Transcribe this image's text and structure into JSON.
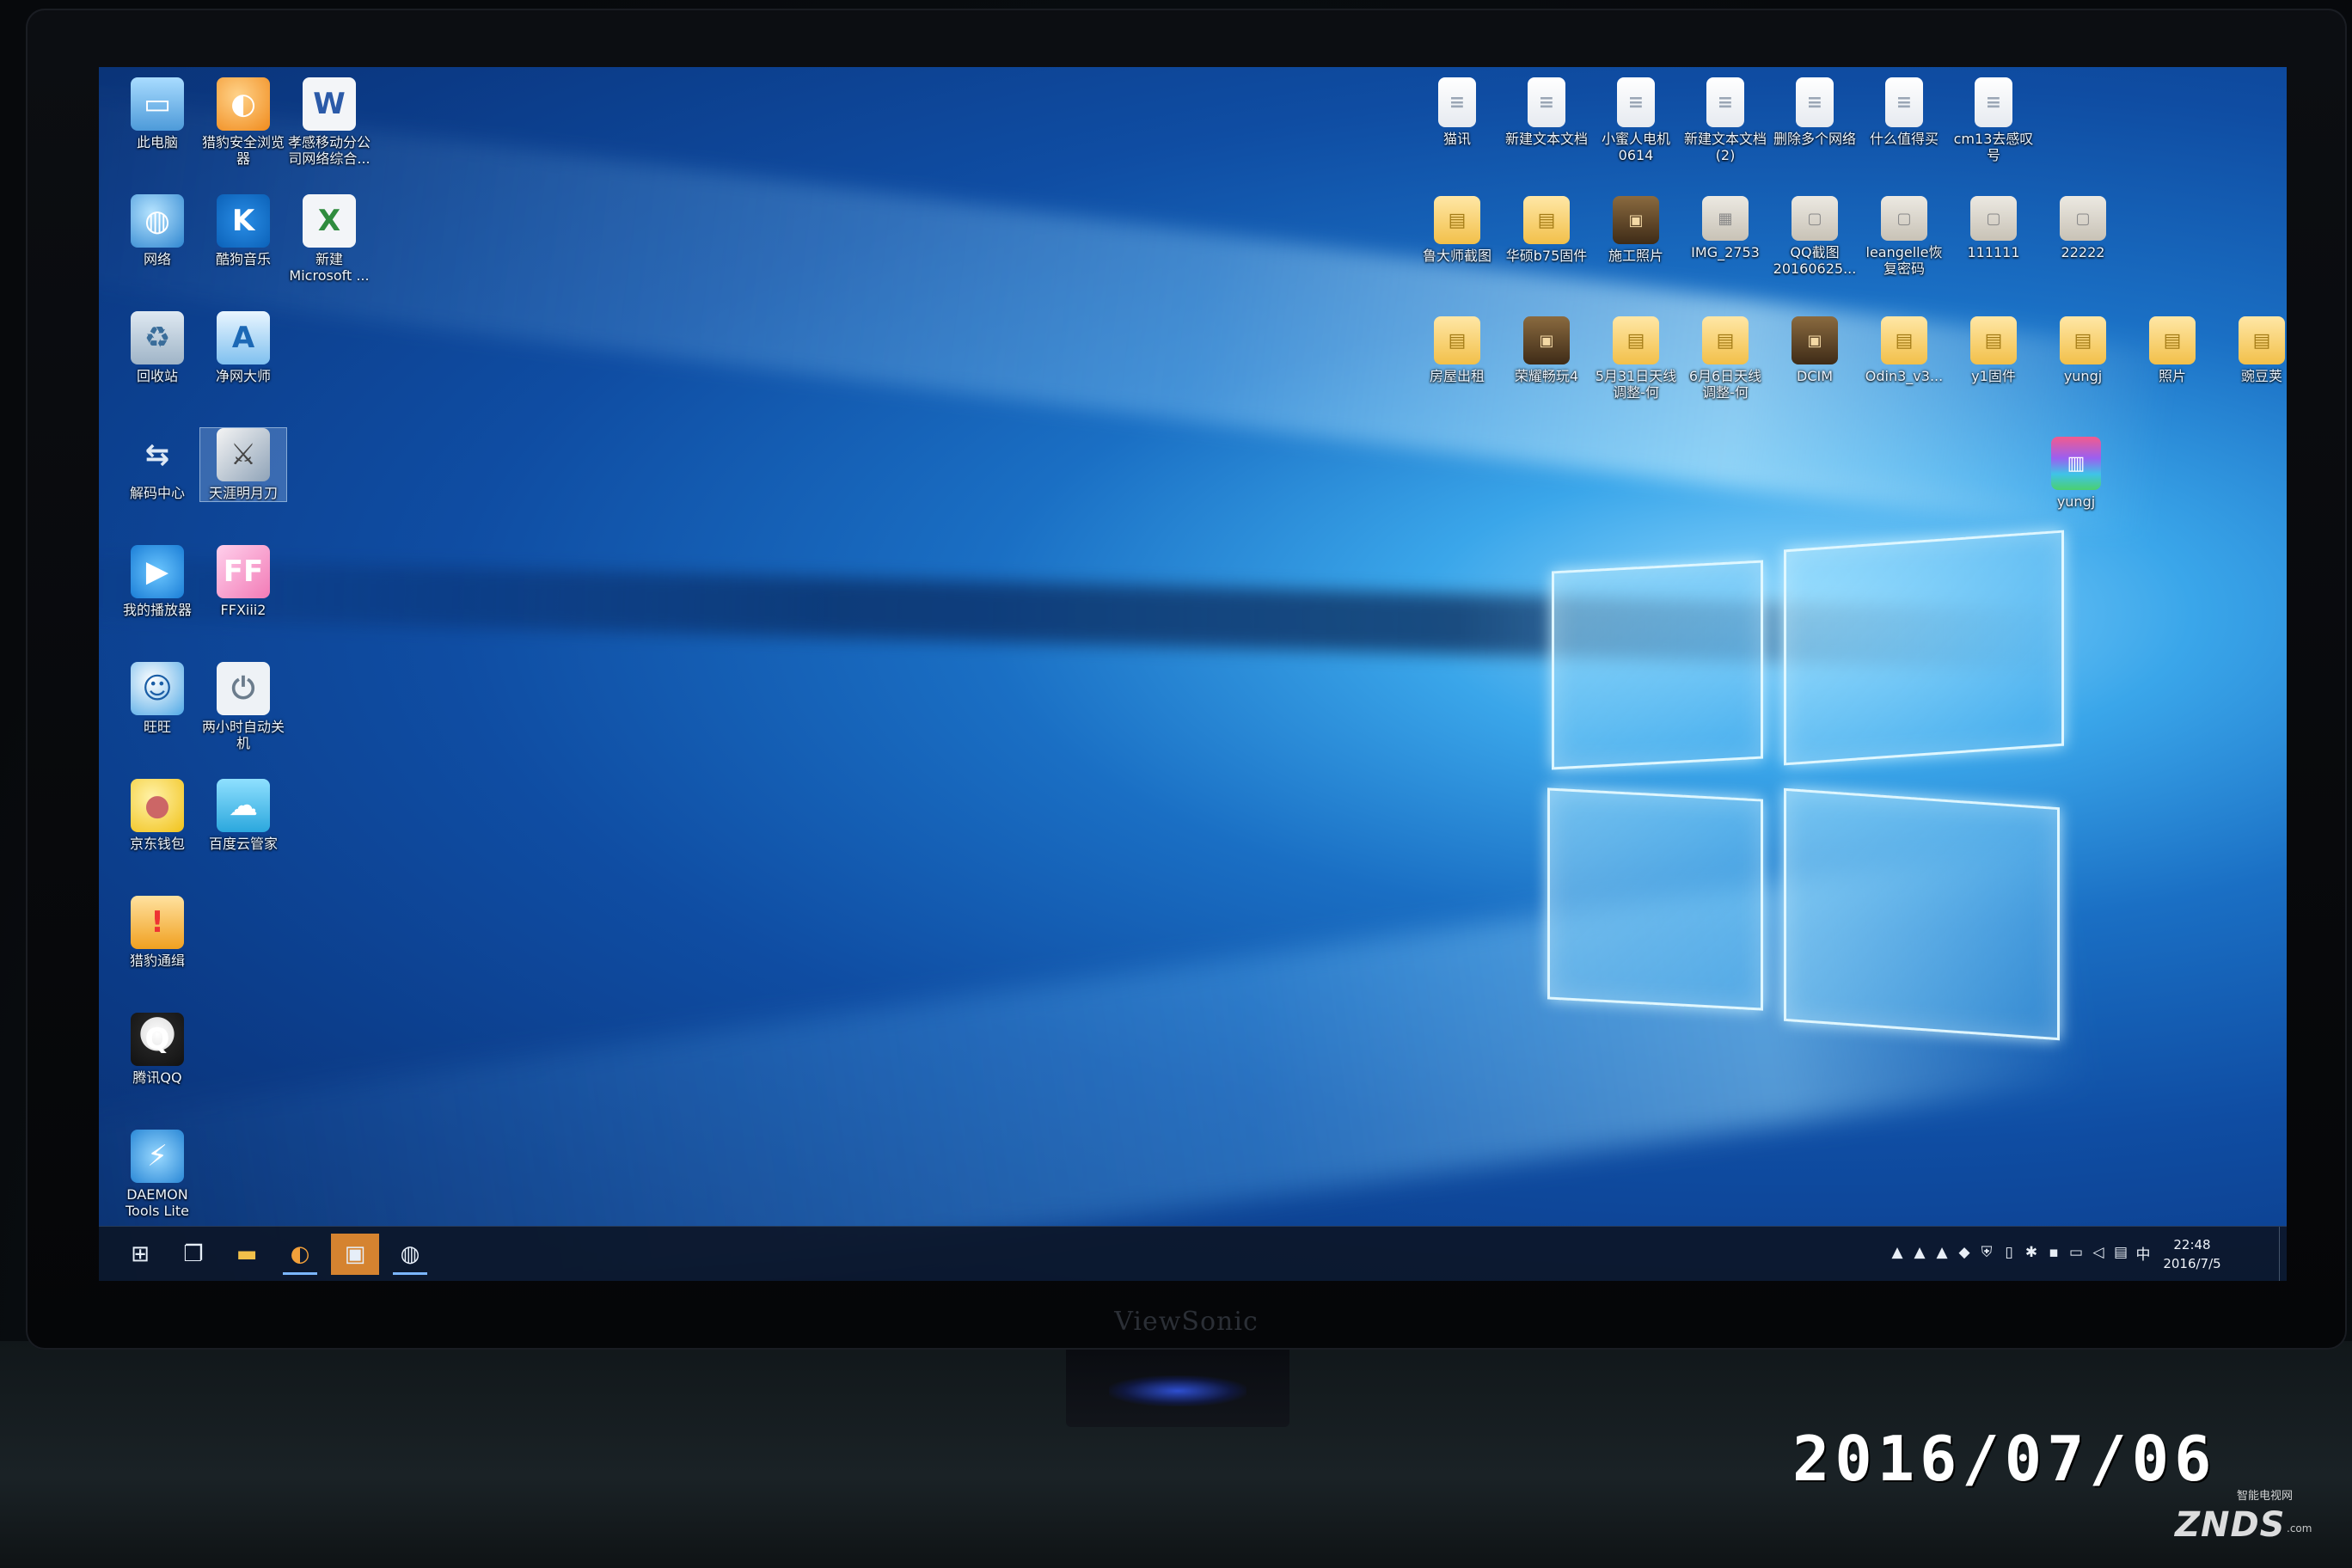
{
  "desktop": {
    "left_icons": [
      {
        "name": "this-pc",
        "label": "此电脑",
        "glyph": "▭",
        "style": "g-pc"
      },
      {
        "name": "liebao-browser",
        "label": "猎豹安全浏览器",
        "glyph": "◐",
        "style": "g-orange"
      },
      {
        "name": "word-doc-mobile",
        "label": "孝感移动分公司网络综合...",
        "glyph": "W",
        "style": "g-doc"
      },
      {
        "name": "network",
        "label": "网络",
        "glyph": "◍",
        "style": "g-net"
      },
      {
        "name": "kugou-music",
        "label": "酷狗音乐",
        "glyph": "K",
        "style": "g-kugou"
      },
      {
        "name": "new-excel",
        "label": "新建 Microsoft ...",
        "glyph": "X",
        "style": "g-xls"
      },
      {
        "name": "recycle-bin",
        "label": "回收站",
        "glyph": "♻",
        "style": "g-bin"
      },
      {
        "name": "jingwang-master",
        "label": "净网大师",
        "glyph": "A",
        "style": "g-clean"
      },
      {
        "name": "decode-center",
        "label": "解码中心",
        "glyph": "⇆",
        "style": "g-decode"
      },
      {
        "name": "tianya-mingyue-dao",
        "label": "天涯明月刀",
        "glyph": "⚔",
        "style": "g-sword",
        "selected": true
      },
      {
        "name": "my-player",
        "label": "我的播放器",
        "glyph": "▶",
        "style": "g-play"
      },
      {
        "name": "ffxiii2",
        "label": "FFXiii2",
        "glyph": "FF",
        "style": "g-fx"
      },
      {
        "name": "wangwang",
        "label": "旺旺",
        "glyph": "☺",
        "style": "g-wang"
      },
      {
        "name": "auto-shutdown",
        "label": "两小时自动关机",
        "glyph": "⏻",
        "style": "g-timer"
      },
      {
        "name": "jd-wallet",
        "label": "京东钱包",
        "glyph": "●",
        "style": "g-jd"
      },
      {
        "name": "baidu-cloud",
        "label": "百度云管家",
        "glyph": "☁",
        "style": "g-cloud"
      },
      {
        "name": "liebao-tongji",
        "label": "猎豹通缉",
        "glyph": "!",
        "style": "g-bz"
      },
      {
        "name": "tencent-qq",
        "label": "腾讯QQ",
        "glyph": "Q",
        "style": "g-qq"
      },
      {
        "name": "daemon-tools",
        "label": "DAEMON Tools Lite",
        "glyph": "⚡",
        "style": "g-daemon"
      }
    ],
    "right_icons_row1": [
      {
        "name": "shortcut-1",
        "label": "猫讯",
        "glyph": "≡",
        "style": "g-file"
      },
      {
        "name": "new-text-1",
        "label": "新建文本文档",
        "glyph": "≡",
        "style": "g-file"
      },
      {
        "name": "xiaomi-laptop",
        "label": "小蜜人电机0614",
        "glyph": "≡",
        "style": "g-file"
      },
      {
        "name": "new-text-2",
        "label": "新建文本文档 (2)",
        "glyph": "≡",
        "style": "g-file"
      },
      {
        "name": "delete-multi-net",
        "label": "删除多个网络",
        "glyph": "≡",
        "style": "g-file"
      },
      {
        "name": "what-to-chat",
        "label": "什么值得买",
        "glyph": "≡",
        "style": "g-file"
      },
      {
        "name": "cm13-remove",
        "label": "cm13去感叹号",
        "glyph": "≡",
        "style": "g-file"
      }
    ],
    "right_icons_row2": [
      {
        "name": "lu-screenshot",
        "label": "鲁大师截图",
        "glyph": "▤",
        "style": "g-folder"
      },
      {
        "name": "huashuo-b75",
        "label": "华硕b75固件",
        "glyph": "▤",
        "style": "g-folder"
      },
      {
        "name": "construction-photos",
        "label": "施工照片",
        "glyph": "▣",
        "style": "g-photo"
      },
      {
        "name": "img-2753",
        "label": "IMG_2753",
        "glyph": "▦",
        "style": "g-img"
      },
      {
        "name": "qq-screenshot",
        "label": "QQ截图20160625...",
        "glyph": "▢",
        "style": "g-img"
      },
      {
        "name": "leangelle-restore",
        "label": "leangelle恢复密码",
        "glyph": "▢",
        "style": "g-img"
      },
      {
        "name": "file-111111",
        "label": "111111",
        "glyph": "▢",
        "style": "g-img"
      },
      {
        "name": "file-22222",
        "label": "22222",
        "glyph": "▢",
        "style": "g-img"
      }
    ],
    "right_icons_row3": [
      {
        "name": "house-rental",
        "label": "房屋出租",
        "glyph": "▤",
        "style": "g-folder"
      },
      {
        "name": "honor-play4",
        "label": "荣耀畅玩4",
        "glyph": "▣",
        "style": "g-photo"
      },
      {
        "name": "may31-tianxian",
        "label": "5月31日天线调整-何",
        "glyph": "▤",
        "style": "g-folder"
      },
      {
        "name": "jun6-tianxian",
        "label": "6月6日天线调整-何",
        "glyph": "▤",
        "style": "g-folder"
      },
      {
        "name": "dcim",
        "label": "DCIM",
        "glyph": "▣",
        "style": "g-photo"
      },
      {
        "name": "odin3",
        "label": "Odin3_v3...",
        "glyph": "▤",
        "style": "g-folder"
      },
      {
        "name": "y1-firmware",
        "label": "y1固件",
        "glyph": "▤",
        "style": "g-folder"
      },
      {
        "name": "yungj-folder",
        "label": "yungj",
        "glyph": "▤",
        "style": "g-folder"
      },
      {
        "name": "photos",
        "label": "照片",
        "glyph": "▤",
        "style": "g-folder"
      },
      {
        "name": "wandoujia",
        "label": "豌豆荚",
        "glyph": "▤",
        "style": "g-folder"
      }
    ],
    "right_icons_row4": [
      {
        "name": "yungj-archive",
        "label": "yungj",
        "glyph": "▥",
        "style": "g-rar"
      }
    ]
  },
  "taskbar": {
    "start_glyph": "⊞",
    "task_view_glyph": "❐",
    "explorer_glyph": "▬",
    "browser_glyph": "◐",
    "active_app_glyph": "▣",
    "pinned_app_glyph": "◍",
    "tray_icons": [
      "▲",
      "▲",
      "▲",
      "◆",
      "⛨",
      "▯",
      "✱",
      "▪",
      "▭",
      "◁",
      "▤",
      "中"
    ],
    "time": "22:48",
    "date": "2016/7/5"
  },
  "monitor": {
    "brand": "ViewSonic"
  },
  "photo": {
    "date_stamp": "2016/07/06",
    "watermark": "ZNDS",
    "watermark_sub": "智能电视网",
    "watermark_suffix": ".com"
  }
}
